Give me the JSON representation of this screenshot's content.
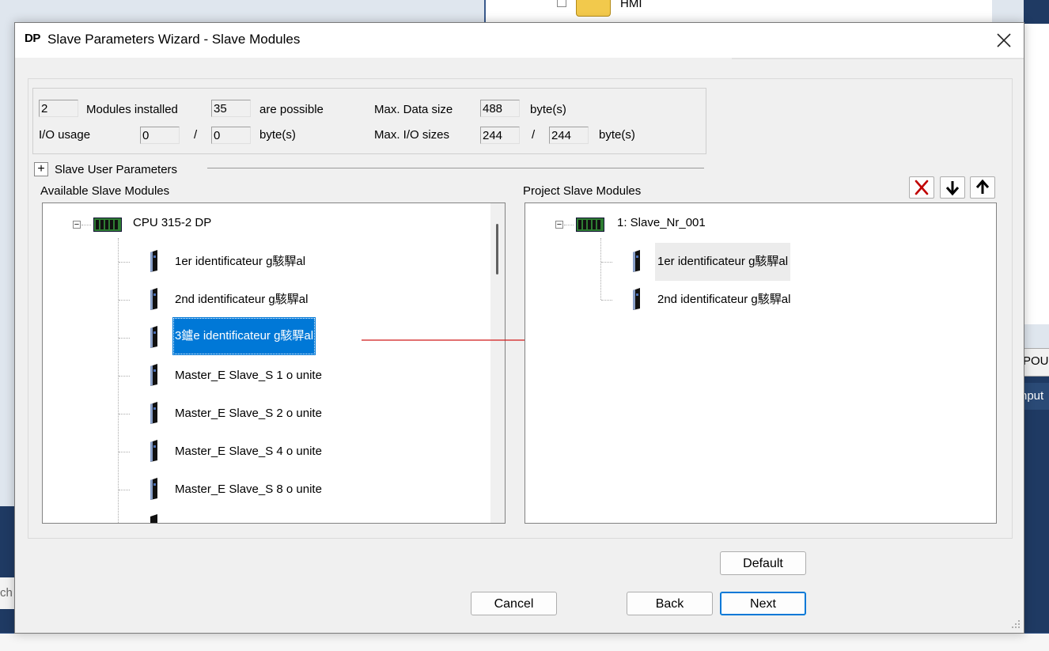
{
  "background": {
    "tree_item": "HMI",
    "right_tab_1": "POU",
    "right_tab_2": "nput",
    "left_tab": "ch"
  },
  "dialog": {
    "app_logo": "DP",
    "title": "Slave Parameters Wizard - Slave Modules",
    "close_glyph": "✕",
    "info": {
      "modules_installed_value": "2",
      "modules_installed_label": "Modules installed",
      "possible_value": "35",
      "possible_label": "are possible",
      "max_data_size_label": "Max. Data size",
      "max_data_size_value": "488",
      "max_data_size_unit": "byte(s)",
      "io_usage_label": "I/O usage",
      "io_usage_in": "0",
      "io_usage_sep": "/",
      "io_usage_out": "0",
      "io_usage_unit": "byte(s)",
      "max_io_sizes_label": "Max. I/O sizes",
      "max_io_in": "244",
      "max_io_sep": "/",
      "max_io_out": "244",
      "max_io_unit": "byte(s)"
    },
    "slave_user_parameters": {
      "expander": "+",
      "label": "Slave User Parameters"
    },
    "available": {
      "label": "Available Slave Modules",
      "root": "CPU 315-2 DP",
      "items": [
        "1er identificateur g駭駻al",
        "2nd identificateur g駭駻al",
        "3鑪e identificateur g駭駻al",
        "Master_E Slave_S  1 o unite",
        "Master_E Slave_S  2 o unite",
        "Master_E Slave_S  4 o unite",
        "Master_E Slave_S  8 o unite"
      ],
      "selected_index": 2
    },
    "project": {
      "label": "Project Slave Modules",
      "root": "1: Slave_Nr_001",
      "items": [
        "1er identificateur g駭駻al",
        "2nd identificateur g駭駻al"
      ]
    },
    "toolbar": {
      "delete_icon": "delete-icon",
      "move_down_icon": "arrow-down-icon",
      "move_up_icon": "arrow-up-icon"
    },
    "buttons": {
      "default": "Default",
      "cancel": "Cancel",
      "back": "Back",
      "next": "Next"
    },
    "colors": {
      "selection": "#0078d7",
      "arrow": "#d11a1a",
      "delete_x": "#c00000"
    }
  }
}
